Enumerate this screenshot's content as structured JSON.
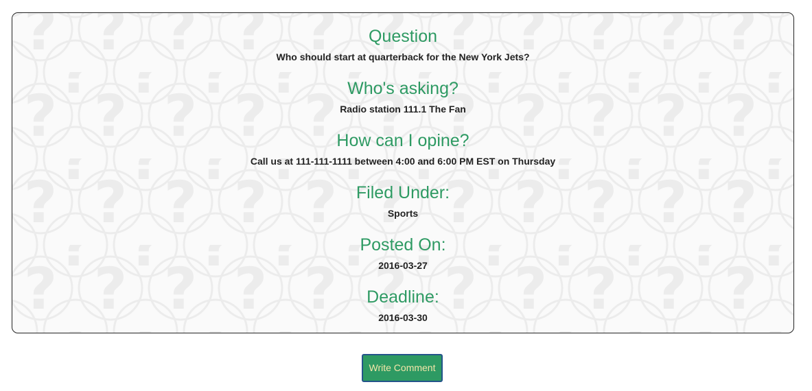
{
  "sections": [
    {
      "heading": "Question",
      "value": "Who should start at quarterback for the New York Jets?"
    },
    {
      "heading": "Who's asking?",
      "value": "Radio station 111.1 The Fan"
    },
    {
      "heading": "How can I opine?",
      "value": "Call us at 111-111-1111 between 4:00 and 6:00 PM EST on Thursday"
    },
    {
      "heading": "Filed Under:",
      "value": "Sports"
    },
    {
      "heading": "Posted On:",
      "value": "2016-03-27"
    },
    {
      "heading": "Deadline:",
      "value": "2016-03-30"
    }
  ],
  "actions": {
    "write_comment_label": "Write Comment"
  },
  "colors": {
    "heading": "#2e9a63",
    "button_bg": "#2e9a63",
    "button_border": "#24548a",
    "button_text": "#f4e6a9",
    "pattern": "#ececec"
  },
  "background_icon": "question-mark-icon"
}
